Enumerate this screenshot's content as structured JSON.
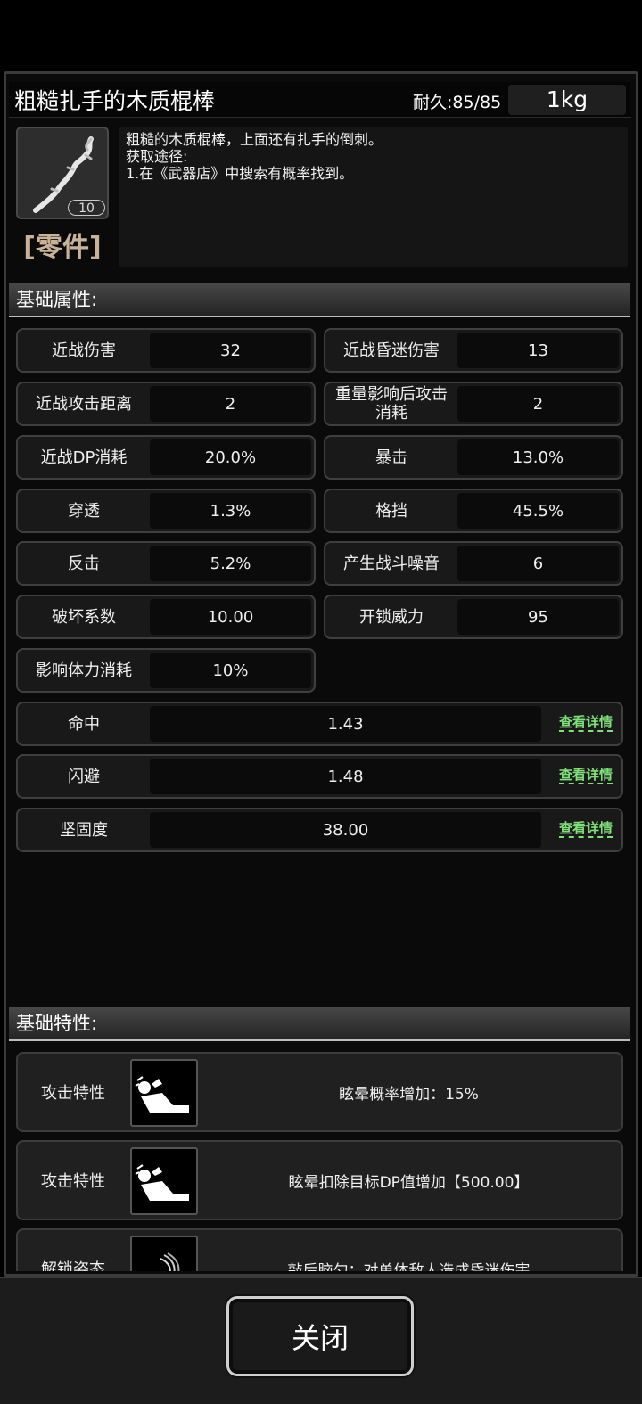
{
  "item": {
    "name": "粗糙扎手的木质棍棒",
    "durability": "耐久:85/85",
    "weight": "1kg",
    "quantity": "10",
    "category": "[零件]",
    "description": [
      "粗糙的木质棍棒，上面还有扎手的倒刺。",
      "获取途径:",
      "1.在《武器店》中搜索有概率找到。"
    ]
  },
  "sections": {
    "basic_attributes": "基础属性:",
    "basic_traits": "基础特性:"
  },
  "stats": [
    {
      "label": "近战伤害",
      "value": "32"
    },
    {
      "label": "近战昏迷伤害",
      "value": "13"
    },
    {
      "label": "近战攻击距离",
      "value": "2"
    },
    {
      "label": "重量影响后攻击\n消耗",
      "value": "2"
    },
    {
      "label": "近战DP消耗",
      "value": "20.0%"
    },
    {
      "label": "暴击",
      "value": "13.0%"
    },
    {
      "label": "穿透",
      "value": "1.3%"
    },
    {
      "label": "格挡",
      "value": "45.5%"
    },
    {
      "label": "反击",
      "value": "5.2%"
    },
    {
      "label": "产生战斗噪音",
      "value": "6"
    },
    {
      "label": "破坏系数",
      "value": "10.00"
    },
    {
      "label": "开锁威力",
      "value": "95"
    },
    {
      "label": "影响体力消耗",
      "value": "10%"
    }
  ],
  "wide_stats": [
    {
      "label": "命中",
      "value": "1.43",
      "detail": "查看详情"
    },
    {
      "label": "闪避",
      "value": "1.48",
      "detail": "查看详情"
    },
    {
      "label": "坚固度",
      "value": "38.00",
      "detail": "查看详情"
    }
  ],
  "traits": [
    {
      "label": "攻击特性",
      "icon": "knockdown-figure-icon",
      "desc": "眩晕概率增加：15%"
    },
    {
      "label": "攻击特性",
      "icon": "knockdown-figure-icon",
      "desc": "眩晕扣除目标DP值增加【500.00】"
    },
    {
      "label": "解锁姿态",
      "icon": "swing-strike-icon",
      "desc": "敲后脑勺：对单体敌人造成昏迷伤害"
    }
  ],
  "close_label": "关闭"
}
